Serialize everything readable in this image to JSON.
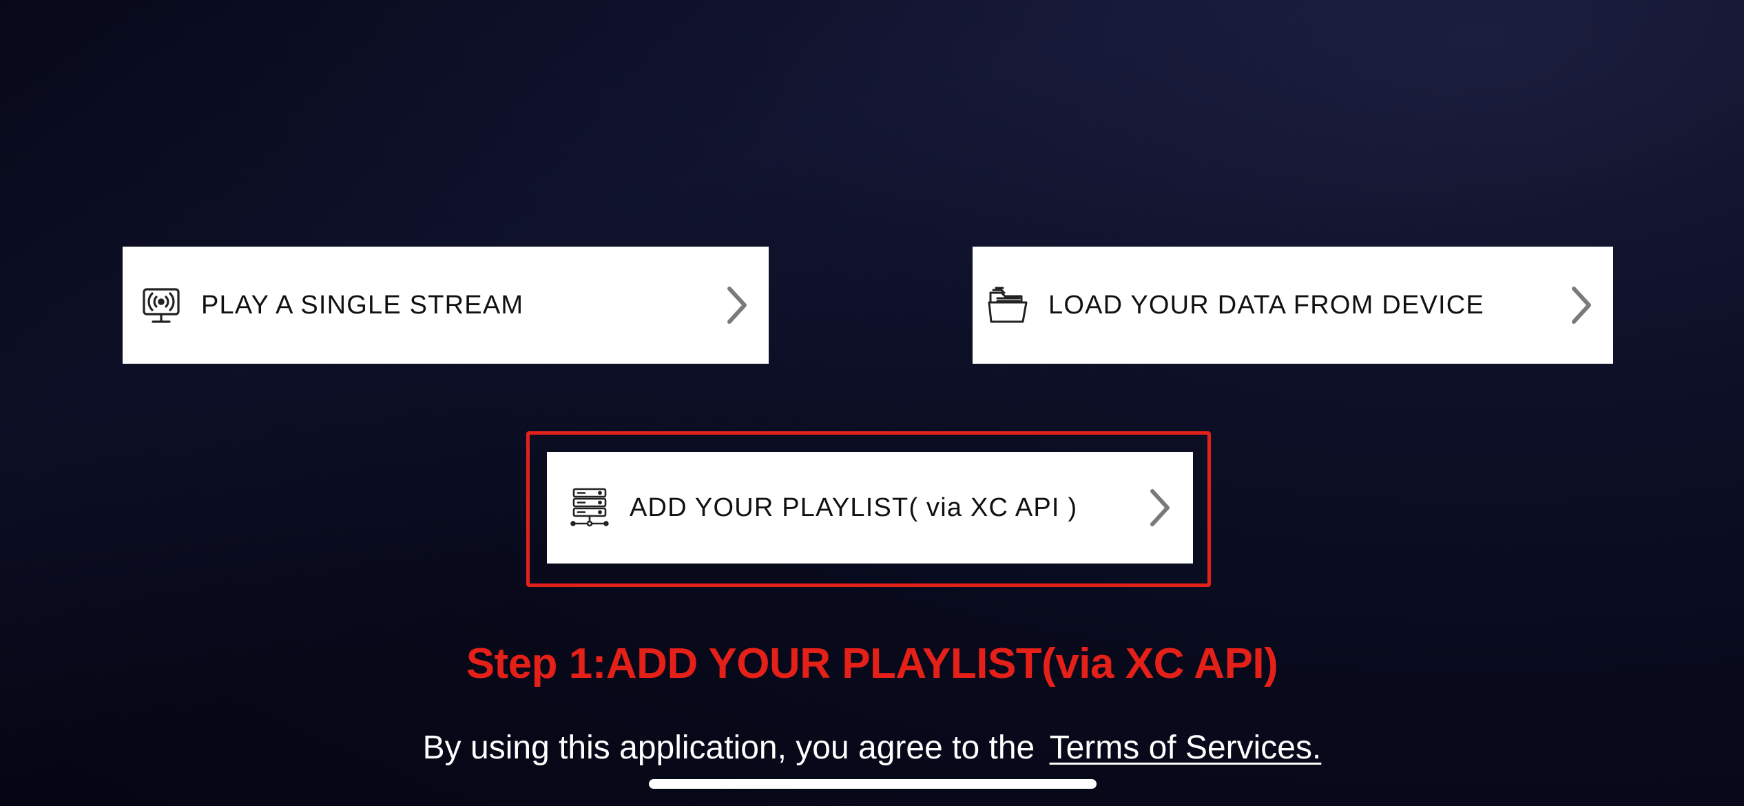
{
  "menu": {
    "single_stream": {
      "label": "PLAY A SINGLE STREAM",
      "icon": "broadcast-monitor-icon"
    },
    "load_device": {
      "label": "LOAD YOUR DATA FROM DEVICE",
      "icon": "folder-icon"
    },
    "add_playlist": {
      "label": "ADD YOUR PLAYLIST( via XC API )",
      "icon": "server-stack-icon"
    },
    "chevron_icon": "chevron-right-icon"
  },
  "annotation": {
    "step_text": "Step 1:ADD YOUR PLAYLIST(via XC API)",
    "highlight_color": "#e3211b"
  },
  "footer": {
    "agreement_text": "By using this application, you agree to the",
    "terms_link": "Terms of Services."
  },
  "colors": {
    "background": "#080a1c",
    "card": "#ffffff",
    "accent_red": "#e52018",
    "chevron": "#7a7a7a"
  }
}
